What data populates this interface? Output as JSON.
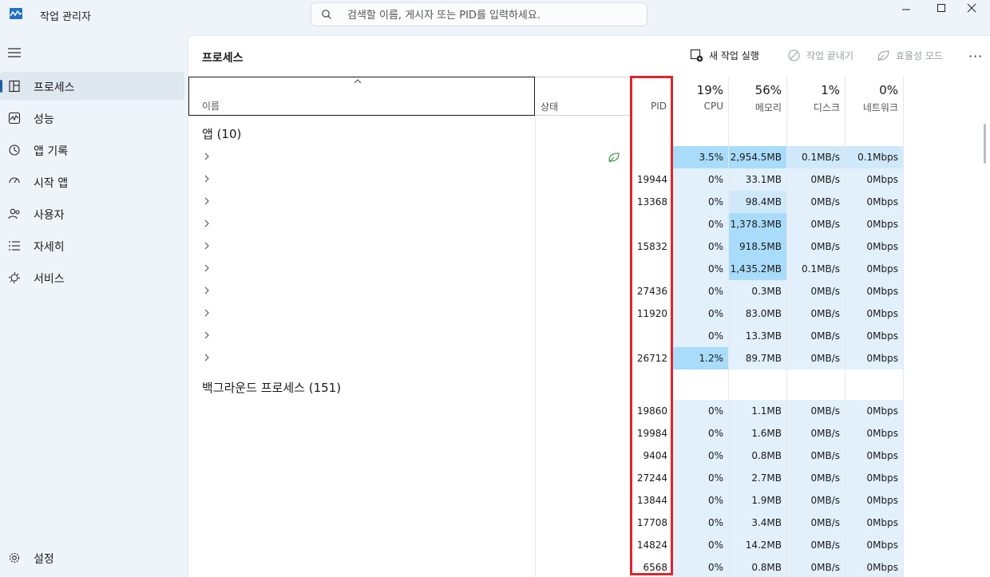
{
  "app": {
    "title": "작업 관리자",
    "search_placeholder": "검색할 이름, 게시자 또는 PID를 입력하세요."
  },
  "sidebar": {
    "items": [
      {
        "label": "프로세스",
        "icon": "processes-icon",
        "active": true
      },
      {
        "label": "성능",
        "icon": "performance-icon"
      },
      {
        "label": "앱 기록",
        "icon": "app-history-icon"
      },
      {
        "label": "시작 앱",
        "icon": "startup-apps-icon"
      },
      {
        "label": "사용자",
        "icon": "users-icon"
      },
      {
        "label": "자세히",
        "icon": "details-icon"
      },
      {
        "label": "서비스",
        "icon": "services-icon"
      }
    ],
    "settings_label": "설정"
  },
  "main": {
    "title": "프로세스",
    "commands": {
      "new_task": "새 작업 실행",
      "end_task": "작업 끝내기",
      "efficiency": "효율성 모드",
      "more": "···"
    }
  },
  "table": {
    "columns": {
      "name": "이름",
      "status": "상태",
      "pid": "PID",
      "cpu": {
        "pct": "19%",
        "label": "CPU"
      },
      "memory": {
        "pct": "56%",
        "label": "메모리"
      },
      "disk": {
        "pct": "1%",
        "label": "디스크"
      },
      "network": {
        "pct": "0%",
        "label": "네트워크"
      }
    },
    "apps_group": "앱 (10)",
    "background_group": "백그라운드 프로세스 (151)",
    "app_rows": [
      {
        "pid": "",
        "cpu": "3.5%",
        "mem": "2,954.5MB",
        "disk": "0.1MB/s",
        "net": "0.1Mbps",
        "efficiency": true
      },
      {
        "pid": "19944",
        "cpu": "0%",
        "mem": "33.1MB",
        "disk": "0MB/s",
        "net": "0Mbps"
      },
      {
        "pid": "13368",
        "cpu": "0%",
        "mem": "98.4MB",
        "disk": "0MB/s",
        "net": "0Mbps"
      },
      {
        "pid": "",
        "cpu": "0%",
        "mem": "1,378.3MB",
        "disk": "0MB/s",
        "net": "0Mbps"
      },
      {
        "pid": "15832",
        "cpu": "0%",
        "mem": "918.5MB",
        "disk": "0MB/s",
        "net": "0Mbps"
      },
      {
        "pid": "",
        "cpu": "0%",
        "mem": "1,435.2MB",
        "disk": "0.1MB/s",
        "net": "0Mbps"
      },
      {
        "pid": "27436",
        "cpu": "0%",
        "mem": "0.3MB",
        "disk": "0MB/s",
        "net": "0Mbps"
      },
      {
        "pid": "11920",
        "cpu": "0%",
        "mem": "83.0MB",
        "disk": "0MB/s",
        "net": "0Mbps"
      },
      {
        "pid": "",
        "cpu": "0%",
        "mem": "13.3MB",
        "disk": "0MB/s",
        "net": "0Mbps"
      },
      {
        "pid": "26712",
        "cpu": "1.2%",
        "mem": "89.7MB",
        "disk": "0MB/s",
        "net": "0Mbps"
      }
    ],
    "bg_rows": [
      {
        "pid": "19860",
        "cpu": "0%",
        "mem": "1.1MB",
        "disk": "0MB/s",
        "net": "0Mbps"
      },
      {
        "pid": "19984",
        "cpu": "0%",
        "mem": "1.6MB",
        "disk": "0MB/s",
        "net": "0Mbps"
      },
      {
        "pid": "9404",
        "cpu": "0%",
        "mem": "0.8MB",
        "disk": "0MB/s",
        "net": "0Mbps"
      },
      {
        "pid": "27244",
        "cpu": "0%",
        "mem": "2.7MB",
        "disk": "0MB/s",
        "net": "0Mbps"
      },
      {
        "pid": "13844",
        "cpu": "0%",
        "mem": "1.9MB",
        "disk": "0MB/s",
        "net": "0Mbps"
      },
      {
        "pid": "17708",
        "cpu": "0%",
        "mem": "3.4MB",
        "disk": "0MB/s",
        "net": "0Mbps"
      },
      {
        "pid": "14824",
        "cpu": "0%",
        "mem": "14.2MB",
        "disk": "0MB/s",
        "net": "0Mbps"
      },
      {
        "pid": "6568",
        "cpu": "0%",
        "mem": "0.8MB",
        "disk": "0MB/s",
        "net": "0Mbps"
      }
    ]
  },
  "colors": {
    "heat_low": "#e1f0fb",
    "heat_mid": "#cfe8fa",
    "heat_high": "#a9dcfb",
    "highlight": "#e0242e"
  }
}
